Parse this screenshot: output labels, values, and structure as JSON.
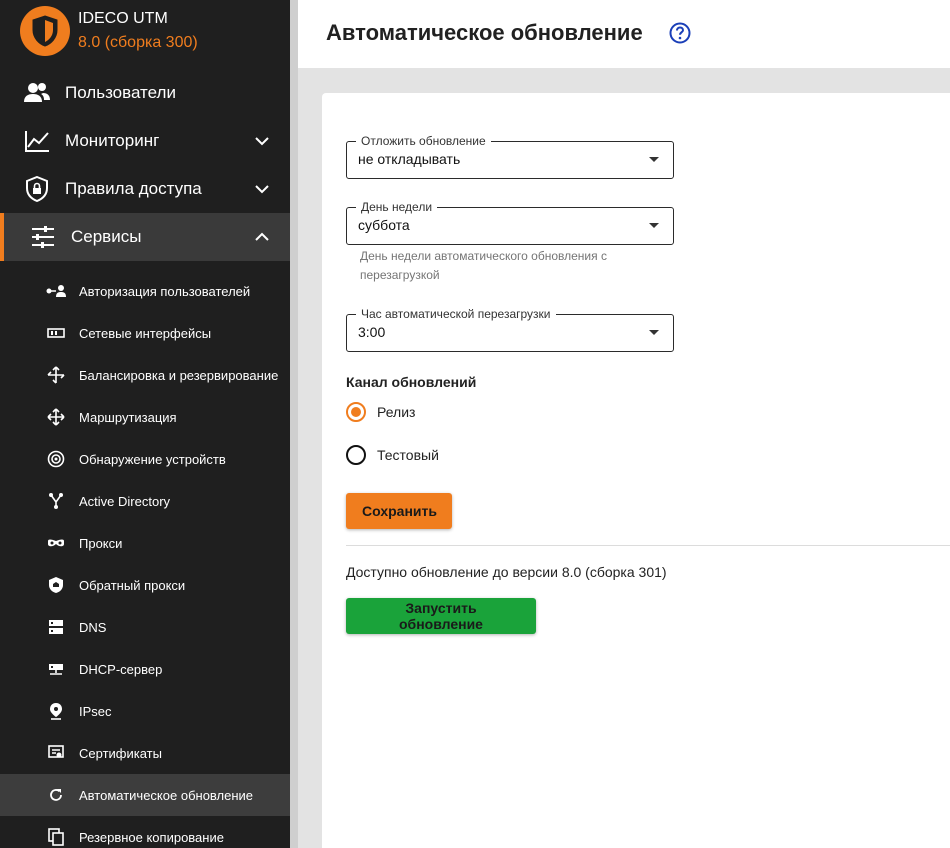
{
  "brand": {
    "name": "IDECO UTM",
    "version": "8.0 (сборка 300)"
  },
  "nav": [
    {
      "label": "Пользователи",
      "icon": "users-icon"
    },
    {
      "label": "Мониторинг",
      "icon": "chart-line-icon"
    },
    {
      "label": "Правила доступа",
      "icon": "shield-lock-icon"
    },
    {
      "label": "Сервисы",
      "icon": "sliders-icon"
    }
  ],
  "services": [
    {
      "label": "Авторизация пользователей",
      "icon": "key-user-icon"
    },
    {
      "label": "Сетевые интерфейсы",
      "icon": "network-card-icon"
    },
    {
      "label": "Балансировка и резервирование",
      "icon": "balance-arrows-icon"
    },
    {
      "label": "Маршрутизация",
      "icon": "routing-arrows-icon"
    },
    {
      "label": "Обнаружение устройств",
      "icon": "radar-icon"
    },
    {
      "label": "Active Directory",
      "icon": "directory-tree-icon"
    },
    {
      "label": "Прокси",
      "icon": "mask-icon"
    },
    {
      "label": "Обратный прокси",
      "icon": "shield-home-icon"
    },
    {
      "label": "DNS",
      "icon": "dns-server-icon"
    },
    {
      "label": "DHCP-сервер",
      "icon": "dhcp-network-icon"
    },
    {
      "label": "IPsec",
      "icon": "location-pin-icon"
    },
    {
      "label": "Сертификаты",
      "icon": "certificate-icon"
    },
    {
      "label": "Автоматическое обновление",
      "icon": "refresh-icon"
    },
    {
      "label": "Резервное копирование",
      "icon": "copy-icon"
    }
  ],
  "page": {
    "title": "Автоматическое обновление"
  },
  "form": {
    "postpone": {
      "label": "Отложить обновление",
      "value": "не откладывать"
    },
    "weekday": {
      "label": "День недели",
      "value": "суббота",
      "hint": "День недели автоматического обновления с перезагрузкой"
    },
    "hour": {
      "label": "Час автоматической перезагрузки",
      "value": "3:00"
    },
    "channel": {
      "title": "Канал обновлений",
      "options": [
        "Релиз",
        "Тестовый"
      ],
      "selected": "Релиз"
    },
    "save_label": "Сохранить",
    "available_text": "Доступно обновление до версии 8.0 (сборка 301)",
    "run_label": "Запустить обновление"
  },
  "colors": {
    "accent": "#f07d1e",
    "run": "#1aa33a",
    "sidebar": "#1f1f1f",
    "help": "#1a3fb8"
  }
}
